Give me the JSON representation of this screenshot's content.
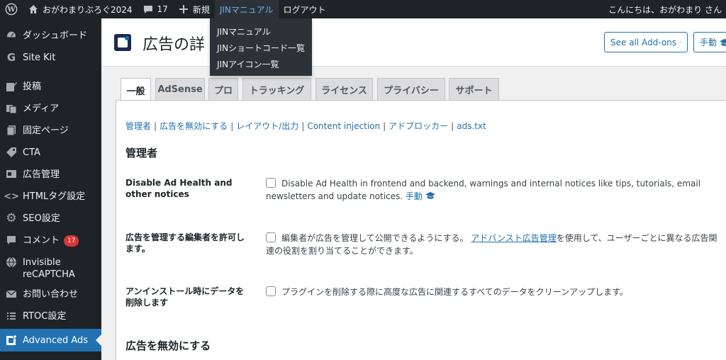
{
  "adminbar": {
    "site_name": "おがわまりぶろぐ2024",
    "comments_count": "17",
    "new_label": "新規",
    "jin_manual": "JINマニュアル",
    "logout": "ログアウト",
    "greeting": "こんにちは、おがわまり さん"
  },
  "dropdown": {
    "items": [
      "JINマニュアル",
      "JINショートコード一覧",
      "JINアイコン一覧"
    ]
  },
  "sidebar": {
    "items": [
      {
        "label": "ダッシュボード",
        "icon": "dashboard-icon"
      },
      {
        "label": "Site Kit",
        "icon": "sitekit-icon"
      },
      {
        "label": "投稿",
        "icon": "posts-icon"
      },
      {
        "label": "メディア",
        "icon": "media-icon"
      },
      {
        "label": "固定ページ",
        "icon": "pages-icon"
      },
      {
        "label": "CTA",
        "icon": "cta-icon"
      },
      {
        "label": "広告管理",
        "icon": "ad-manage-icon"
      },
      {
        "label": "HTMLタグ設定",
        "icon": "code-icon"
      },
      {
        "label": "SEO設定",
        "icon": "gear-icon"
      },
      {
        "label": "コメント",
        "icon": "comment-icon",
        "badge": "17"
      },
      {
        "label": "Invisible reCAPTCHA",
        "icon": "globe-icon"
      },
      {
        "label": "お問い合わせ",
        "icon": "mail-icon"
      },
      {
        "label": "RTOC設定",
        "icon": "list-icon"
      },
      {
        "label": "Advanced Ads",
        "icon": "advanced-ads-icon"
      }
    ]
  },
  "header": {
    "title": "広告の詳",
    "see_addons": "See all Add-ons",
    "manual_btn": "手動"
  },
  "tabs": [
    "一般",
    "AdSense",
    "プロ",
    "トラッキング",
    "ライセンス",
    "プライバシー",
    "サポート"
  ],
  "subnav": [
    "管理者",
    "広告を無効にする",
    "レイアウト/出力",
    "Content injection",
    "アドブロッカー",
    "ads.txt"
  ],
  "sections": {
    "admin_heading": "管理者",
    "disable_heading": "広告を無効にする"
  },
  "rows": {
    "row1_label": "Disable Ad Health and other notices",
    "row1_text": "Disable Ad Health in frontend and backend, warnings and internal notices like tips, tutorials, email newsletters and update notices.",
    "row1_link": "手動",
    "row2_label": "広告を管理する編集者を許可します。",
    "row2_text_a": "編集者が広告を管理して公開できるようにする。",
    "row2_link": "アドバンスト広告管理",
    "row2_text_b": "を使用して、ユーザーごとに異なる広告関連の役割を割り当てることができます。",
    "row3_label": "アンインストール時にデータを削除します",
    "row3_text": "プラグインを削除する際に高度な広告に関連するすべてのデータをクリーンアップします。"
  },
  "colors": {
    "adminbar_bg": "#1d2327",
    "accent": "#2271b1",
    "active_link": "#72aee6",
    "badge": "#d63638"
  }
}
